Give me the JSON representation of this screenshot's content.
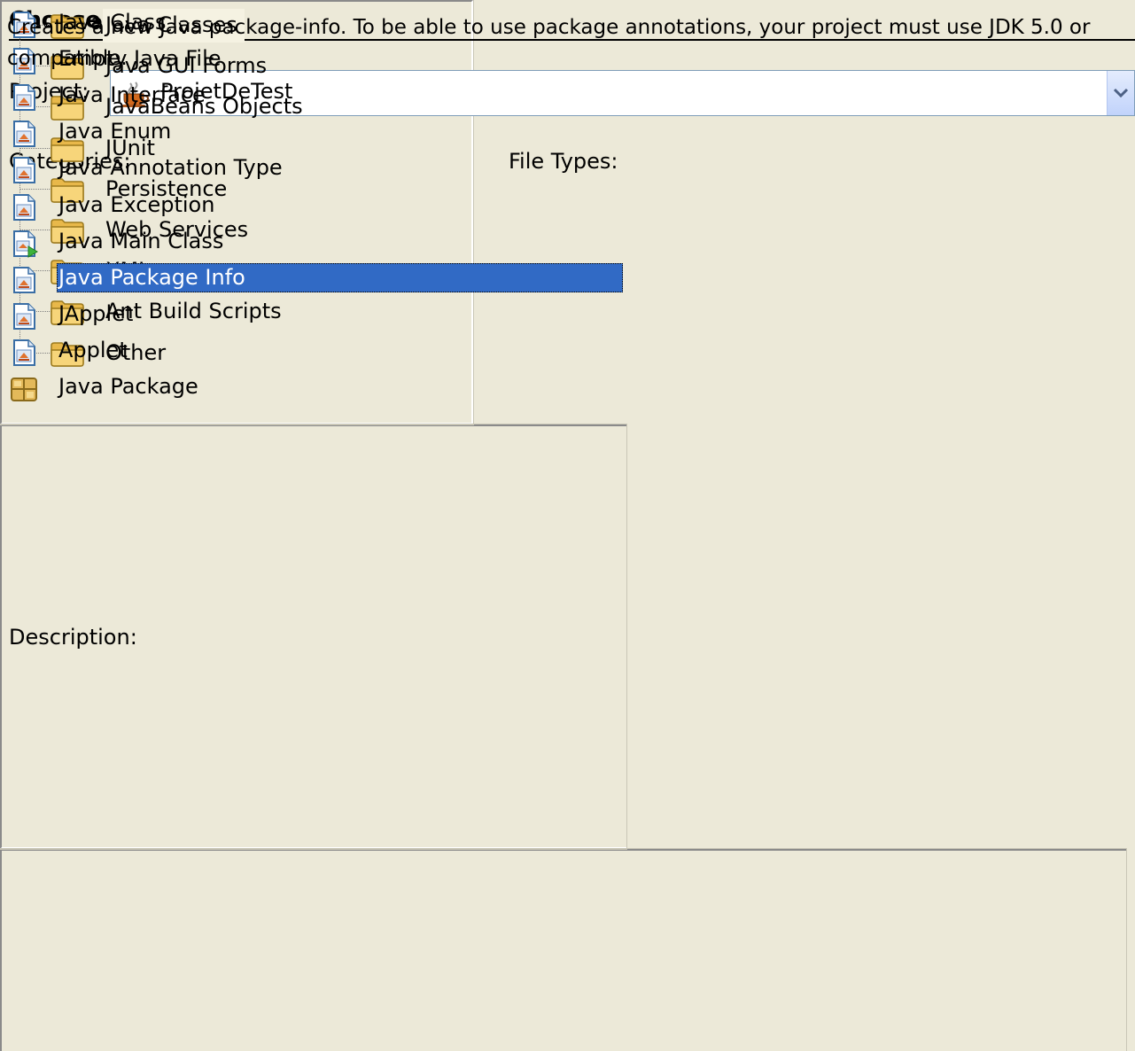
{
  "dialog": {
    "title": "Choose File Type"
  },
  "project": {
    "label": "Project:",
    "value": "ProjetDeTest"
  },
  "categories": {
    "label": "Categories:",
    "items": [
      {
        "label": "Java Classes",
        "expandable": false,
        "selected": true
      },
      {
        "label": "Java GUI Forms",
        "expandable": true,
        "expander": "+"
      },
      {
        "label": "JavaBeans Objects"
      },
      {
        "label": "JUnit"
      },
      {
        "label": "Persistence"
      },
      {
        "label": "Web Services"
      },
      {
        "label": "XML"
      },
      {
        "label": "Ant Build Scripts"
      },
      {
        "label": "Other"
      }
    ]
  },
  "file_types": {
    "label": "File Types:",
    "items": [
      {
        "label": "Java Class",
        "icon": "java-file-icon"
      },
      {
        "label": "Empty Java File",
        "icon": "java-file-icon"
      },
      {
        "label": "Java Interface",
        "icon": "java-file-icon"
      },
      {
        "label": "Java Enum",
        "icon": "java-file-icon"
      },
      {
        "label": "Java Annotation Type",
        "icon": "java-file-icon"
      },
      {
        "label": "Java Exception",
        "icon": "java-file-icon"
      },
      {
        "label": "Java Main Class",
        "icon": "java-main-class-icon"
      },
      {
        "label": "Java Package Info",
        "icon": "java-file-icon",
        "selected": true
      },
      {
        "label": "JApplet",
        "icon": "java-file-icon"
      },
      {
        "label": "Applet",
        "icon": "java-file-icon"
      },
      {
        "label": "Java Package",
        "icon": "java-package-icon"
      }
    ]
  },
  "description": {
    "label": "Description:",
    "text": "Creates a new Java package-info. To be able to use package annotations, your project must use JDK 5.0 or compatible."
  },
  "colors": {
    "background": "#ece9d8",
    "selection": "#316ac5",
    "folder": "#f7d57a"
  }
}
